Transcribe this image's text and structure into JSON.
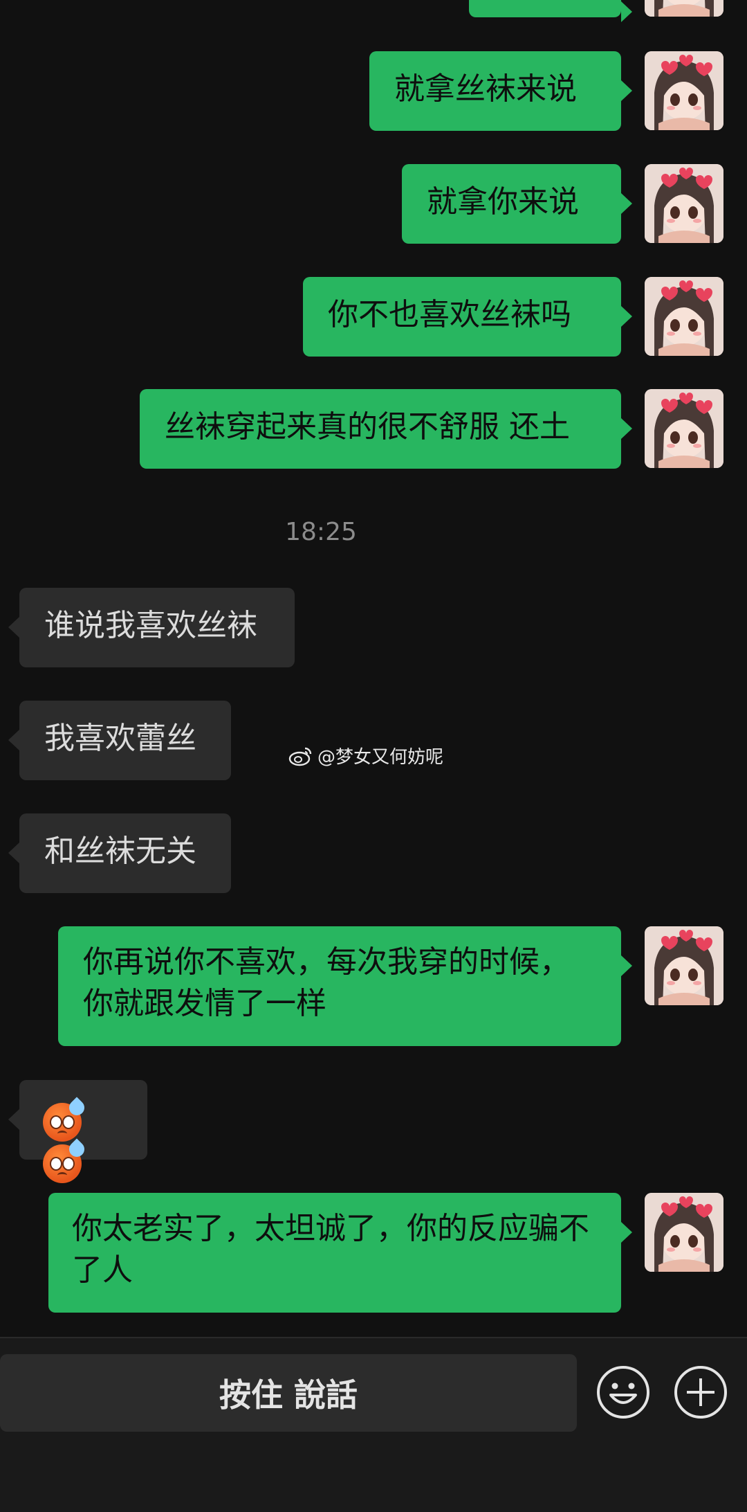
{
  "messages": [
    {
      "side": "sent",
      "text": ""
    },
    {
      "side": "sent",
      "text": "就拿丝袜来说"
    },
    {
      "side": "sent",
      "text": "就拿你来说"
    },
    {
      "side": "sent",
      "text": "你不也喜欢丝袜吗"
    },
    {
      "side": "sent",
      "text": "丝袜穿起来真的很不舒服 还土"
    },
    {
      "side": "recv",
      "text": "谁说我喜欢丝袜"
    },
    {
      "side": "recv",
      "text": "我喜欢蕾丝"
    },
    {
      "side": "recv",
      "text": "和丝袜无关"
    },
    {
      "side": "sent",
      "text": "你再说你不喜欢，每次我穿的时候，你就跟发情了一样"
    },
    {
      "side": "recv",
      "text": "",
      "emoji": [
        "anxious-face-with-sweat",
        "anxious-face-with-sweat"
      ]
    },
    {
      "side": "sent",
      "text": "你太老实了，太坦诚了，你的反应骗不了人"
    }
  ],
  "timestamp": "18:25",
  "watermark": "@梦女又何妨呢",
  "input_bar": {
    "voice_label": "按住 說話",
    "emoji_button_icon": "smiley-icon",
    "plus_button_icon": "plus-icon"
  },
  "colors": {
    "background": "#111111",
    "sent_bubble": "#28b660",
    "received_bubble": "#2c2c2c"
  }
}
